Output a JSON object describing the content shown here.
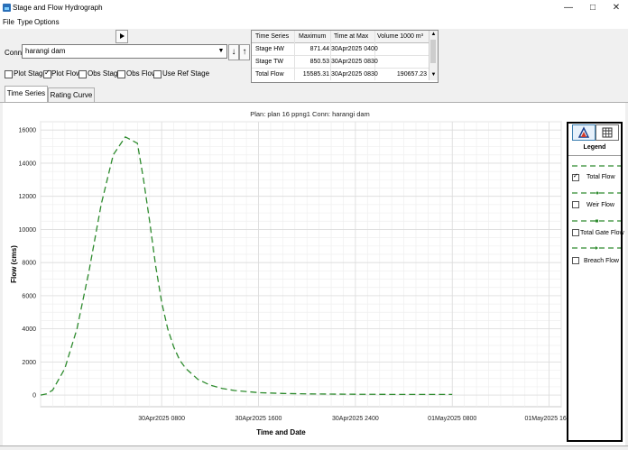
{
  "window": {
    "title": "Stage and Flow Hydrograph",
    "minimize": "—",
    "maximize": "□",
    "close": "✕"
  },
  "menu": [
    "File",
    "Type",
    "Options"
  ],
  "conn": {
    "label": "Conn:",
    "value": "harangi dam"
  },
  "stats_table": {
    "headers": [
      "Time Series",
      "Maximum",
      "Time at Max",
      "Volume 1000 m³"
    ],
    "rows": [
      [
        "Stage HW",
        "871.44",
        "30Apr2025 0400",
        ""
      ],
      [
        "Stage TW",
        "850.53",
        "30Apr2025 0830",
        ""
      ],
      [
        "Total Flow",
        "15585.31",
        "30Apr2025 0830",
        "190657.23"
      ]
    ]
  },
  "options": [
    {
      "label": "Plot Stage",
      "checked": false
    },
    {
      "label": "Plot Flow",
      "checked": true
    },
    {
      "label": "Obs Stage",
      "checked": false
    },
    {
      "label": "Obs Flow",
      "checked": false
    },
    {
      "label": "Use Ref Stage",
      "checked": false
    }
  ],
  "tabs": [
    {
      "label": "Time Series",
      "active": true
    },
    {
      "label": "Rating Curve",
      "active": false
    }
  ],
  "legend": {
    "title": "Legend",
    "items": [
      {
        "label": "Total Flow",
        "checked": true
      },
      {
        "label": "Weir Flow",
        "checked": false
      },
      {
        "label": "Total Gate Flow",
        "checked": false
      },
      {
        "label": "Breach Flow",
        "checked": false
      }
    ],
    "color": "#2e8b2e"
  },
  "chart_data": {
    "type": "line",
    "title": "Plan: plan 16 ppng1     Conn: harangi dam",
    "xlabel": "Time and Date",
    "ylabel": "Flow (cms)",
    "ylim": [
      -700,
      16500
    ],
    "yticks": [
      0,
      2000,
      4000,
      6000,
      8000,
      10000,
      12000,
      14000,
      16000
    ],
    "xlim_hours_from_30Apr2025_0000": [
      -2,
      41
    ],
    "xticks": [
      {
        "label": "30Apr2025 0800",
        "hour": 8
      },
      {
        "label": "30Apr2025 1600",
        "hour": 16
      },
      {
        "label": "30Apr2025 2400",
        "hour": 24
      },
      {
        "label": "01May2025 0800",
        "hour": 32
      },
      {
        "label": "01May2025 1600",
        "hour": 40
      }
    ],
    "grid": true,
    "series": [
      {
        "name": "Total Flow",
        "color": "#2e8b2e",
        "dash": "dashed",
        "x_hours": [
          -2,
          -1.5,
          -1,
          0,
          1,
          2,
          3,
          4,
          5,
          6,
          6.5,
          7,
          7.5,
          8,
          8.5,
          9,
          9.5,
          10,
          11,
          12,
          13,
          14,
          16,
          18,
          20,
          22,
          24,
          26,
          28,
          30,
          32
        ],
        "values": [
          0,
          80,
          300,
          1600,
          4000,
          7500,
          11500,
          14500,
          15585,
          15200,
          13000,
          10500,
          7800,
          5600,
          4000,
          2900,
          2100,
          1600,
          950,
          600,
          400,
          280,
          150,
          100,
          75,
          60,
          50,
          45,
          42,
          40,
          40
        ]
      }
    ]
  }
}
